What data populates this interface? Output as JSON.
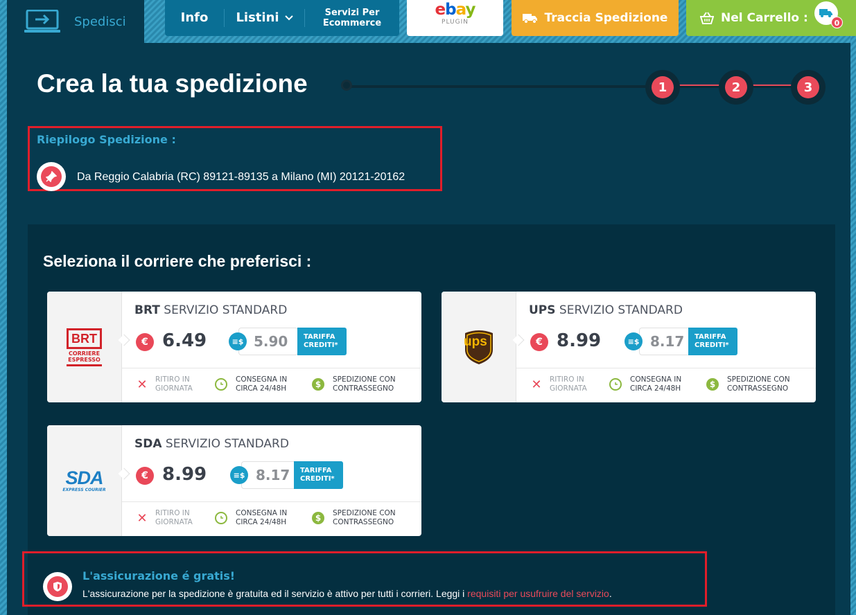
{
  "nav": {
    "spedisci": "Spedisci",
    "info": "Info",
    "listini": "Listini",
    "servizi_line1": "Servizi Per",
    "servizi_line2": "Ecommerce",
    "ebay_e": "e",
    "ebay_b": "b",
    "ebay_a": "a",
    "ebay_y": "y",
    "ebay_plugin": "PLUGIN",
    "traccia": "Traccia Spedizione",
    "carrello": "Nel Carrello :",
    "cart_count": "0"
  },
  "page": {
    "title": "Crea la tua spedizione",
    "steps": [
      "1",
      "2",
      "3"
    ]
  },
  "summary": {
    "title": "Riepilogo Spedizione :",
    "route": "Da Reggio Calabria (RC) 89121-89135 a Milano (MI) 20121-20162"
  },
  "couriers": {
    "title": "Seleziona il corriere che preferisci :",
    "euro_symbol": "€",
    "credit_symbol": "≡$",
    "tariffa_line1": "TARIFFA",
    "tariffa_line2": "CREDITI*",
    "features": {
      "ritiro_line1": "RITIRO IN",
      "ritiro_line2": "GIORNATA",
      "consegna_line1": "CONSEGNA IN",
      "consegna_line2": "CIRCA 24/48H",
      "contrassegno_line1": "SPEDIZIONE CON",
      "contrassegno_line2": "CONTRASSEGNO"
    },
    "items": [
      {
        "brand": "BRT",
        "service": "SERVIZIO STANDARD",
        "price": "6.49",
        "credit_price": "5.90",
        "logo_main": "BRT",
        "logo_sub1": "CORRIERE",
        "logo_sub2": "ESPRESSO"
      },
      {
        "brand": "UPS",
        "service": "SERVIZIO STANDARD",
        "price": "8.99",
        "credit_price": "8.17",
        "logo_main": "ups"
      },
      {
        "brand": "SDA",
        "service": "SERVIZIO STANDARD",
        "price": "8.99",
        "credit_price": "8.17",
        "logo_main": "SDA",
        "logo_sub1": "EXPRESS COURIER"
      }
    ]
  },
  "insurance": {
    "title": "L'assicurazione é gratis!",
    "text": "L'assicurazione per la spedizione è gratuita ed il servizio è attivo per tutti i corrieri. Leggi i ",
    "link": "requisiti per usufruire del servizio",
    "end": "."
  },
  "colors": {
    "background": "#063a4f",
    "accent_blue": "#38a9d2",
    "accent_red": "#ea4a5a",
    "orange": "#f2ac2e",
    "green": "#8cc63f",
    "annotation_red": "#e01e2a"
  },
  "icons": [
    "laptop-arrow-icon",
    "chevron-down-icon",
    "truck-icon",
    "basket-icon",
    "cart-truck-icon",
    "pin-icon",
    "euro-icon",
    "credit-icon",
    "cross-icon",
    "clock-icon",
    "dollar-icon",
    "shield-icon"
  ]
}
